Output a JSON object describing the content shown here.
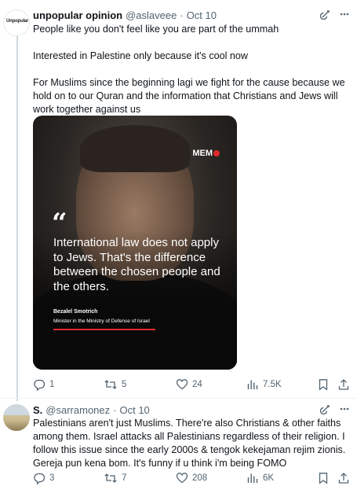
{
  "tweets": [
    {
      "avatar_text": "Unpopular",
      "display_name": "unpopular opinion",
      "handle": "@aslaveee",
      "separator": "·",
      "date": "Oct 10",
      "paragraphs": [
        "People like you don't feel like you are part of the ummah",
        "Interested in Palestine only because it's cool now",
        "For Muslims since the beginning lagi we fight for the cause because we hold on to our Quran and the information that Christians and Jews will work together against us"
      ],
      "media": {
        "logo": "MEM",
        "quote_mark": "“",
        "quote_text": "International law does not apply to Jews. That's the difference between the chosen people and the others.",
        "quote_author": "Bezalel Smotrich",
        "quote_role": "Minister in the Ministry of Defense of Israel"
      },
      "stats": {
        "replies": "1",
        "retweets": "5",
        "likes": "24",
        "views": "7.5K"
      }
    },
    {
      "display_name": "S.",
      "handle": "@sarramonez",
      "separator": "·",
      "date": "Oct 10",
      "text": "Palestinians aren't just Muslims. There're also Christians & other faiths among them. Israel attacks all Palestinians regardless of their religion. I follow this issue since the early 2000s & tengok kekejaman rejim zionis. Gereja pun kena bom. It's funny if u think i'm being FOMO",
      "stats": {
        "replies": "3",
        "retweets": "7",
        "likes": "208",
        "views": "6K"
      }
    }
  ],
  "icons": [
    "grok-icon",
    "more-icon",
    "reply-icon",
    "retweet-icon",
    "like-icon",
    "views-icon",
    "bookmark-icon",
    "share-icon"
  ],
  "colors": {
    "text": "#0f1419",
    "secondary": "#536471",
    "thread_line": "#cfd9de",
    "logo_red": "#e02b2b"
  }
}
